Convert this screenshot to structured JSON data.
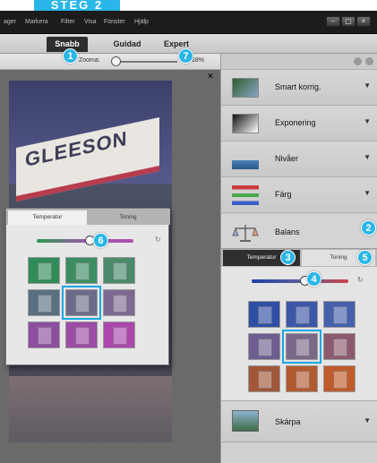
{
  "step_banner": "STEG 2",
  "menubar": {
    "items": [
      "ager",
      "Markera",
      "Filter",
      "Visa",
      "Fönster",
      "Hjälp"
    ],
    "window_buttons": [
      "–",
      "▢",
      "×"
    ]
  },
  "modes": {
    "tabs": [
      "Snabb",
      "Guidad",
      "Expert"
    ],
    "active": "Snabb"
  },
  "zoom": {
    "label": "Zooma:",
    "value_text": "18%"
  },
  "canvas": {
    "close_label": "×",
    "photo_sign_text": "GLEESON"
  },
  "adjustments": {
    "items": [
      {
        "label": "Smart korrig.",
        "chevron": "▼"
      },
      {
        "label": "Exponering",
        "chevron": "▼"
      },
      {
        "label": "Nivåer",
        "chevron": "▼"
      },
      {
        "label": "Färg",
        "chevron": "▼"
      },
      {
        "label": "Balans",
        "chevron": ""
      },
      {
        "label": "Skärpa",
        "chevron": "▼"
      }
    ]
  },
  "balance": {
    "tabs": [
      "Temperatur",
      "Toning"
    ],
    "active_tab": "Temperatur",
    "temperature_level": 0.55,
    "selected_cell": 4
  },
  "popup": {
    "tabs": [
      "Temperatur",
      "Toning"
    ],
    "active_tab": "Temperatur",
    "tint_level": 0.55,
    "selected_cell": 4
  },
  "badges": [
    "1",
    "2",
    "3",
    "4",
    "5",
    "6",
    "7"
  ],
  "colors": {
    "accent": "#29b6e8",
    "menubar": "#1c1c1c",
    "selection": "#1aa7e5"
  },
  "icons": {
    "settings": "gear-icon",
    "home": "home-icon"
  }
}
